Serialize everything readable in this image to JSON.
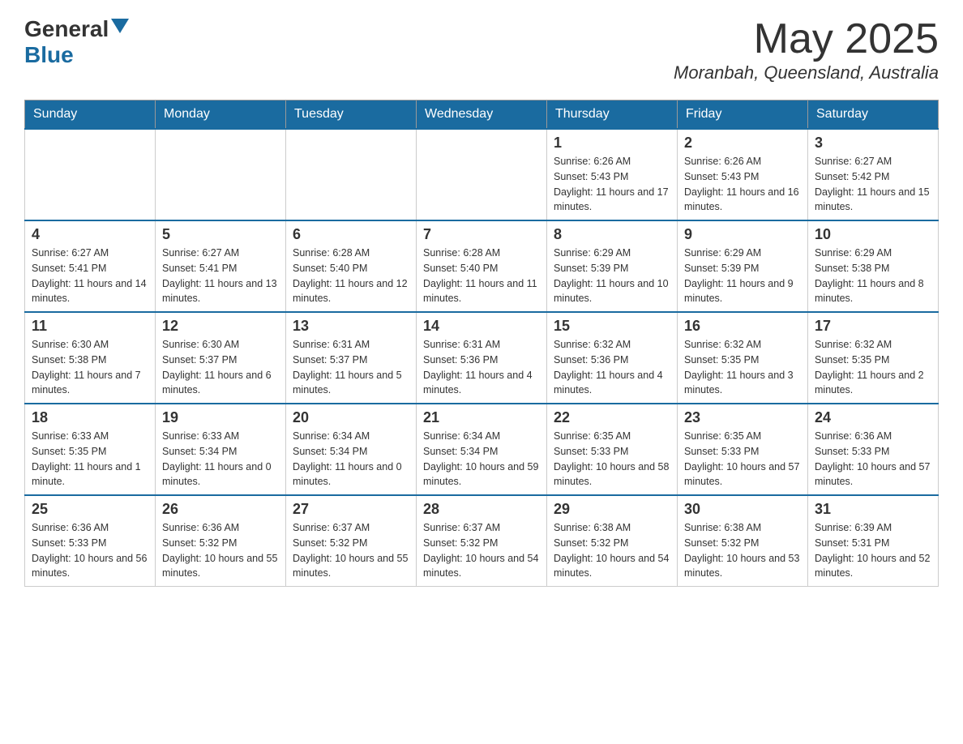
{
  "logo": {
    "general": "General",
    "blue": "Blue"
  },
  "title": "May 2025",
  "location": "Moranbah, Queensland, Australia",
  "days_of_week": [
    "Sunday",
    "Monday",
    "Tuesday",
    "Wednesday",
    "Thursday",
    "Friday",
    "Saturday"
  ],
  "weeks": [
    [
      {
        "day": "",
        "info": ""
      },
      {
        "day": "",
        "info": ""
      },
      {
        "day": "",
        "info": ""
      },
      {
        "day": "",
        "info": ""
      },
      {
        "day": "1",
        "info": "Sunrise: 6:26 AM\nSunset: 5:43 PM\nDaylight: 11 hours and 17 minutes."
      },
      {
        "day": "2",
        "info": "Sunrise: 6:26 AM\nSunset: 5:43 PM\nDaylight: 11 hours and 16 minutes."
      },
      {
        "day": "3",
        "info": "Sunrise: 6:27 AM\nSunset: 5:42 PM\nDaylight: 11 hours and 15 minutes."
      }
    ],
    [
      {
        "day": "4",
        "info": "Sunrise: 6:27 AM\nSunset: 5:41 PM\nDaylight: 11 hours and 14 minutes."
      },
      {
        "day": "5",
        "info": "Sunrise: 6:27 AM\nSunset: 5:41 PM\nDaylight: 11 hours and 13 minutes."
      },
      {
        "day": "6",
        "info": "Sunrise: 6:28 AM\nSunset: 5:40 PM\nDaylight: 11 hours and 12 minutes."
      },
      {
        "day": "7",
        "info": "Sunrise: 6:28 AM\nSunset: 5:40 PM\nDaylight: 11 hours and 11 minutes."
      },
      {
        "day": "8",
        "info": "Sunrise: 6:29 AM\nSunset: 5:39 PM\nDaylight: 11 hours and 10 minutes."
      },
      {
        "day": "9",
        "info": "Sunrise: 6:29 AM\nSunset: 5:39 PM\nDaylight: 11 hours and 9 minutes."
      },
      {
        "day": "10",
        "info": "Sunrise: 6:29 AM\nSunset: 5:38 PM\nDaylight: 11 hours and 8 minutes."
      }
    ],
    [
      {
        "day": "11",
        "info": "Sunrise: 6:30 AM\nSunset: 5:38 PM\nDaylight: 11 hours and 7 minutes."
      },
      {
        "day": "12",
        "info": "Sunrise: 6:30 AM\nSunset: 5:37 PM\nDaylight: 11 hours and 6 minutes."
      },
      {
        "day": "13",
        "info": "Sunrise: 6:31 AM\nSunset: 5:37 PM\nDaylight: 11 hours and 5 minutes."
      },
      {
        "day": "14",
        "info": "Sunrise: 6:31 AM\nSunset: 5:36 PM\nDaylight: 11 hours and 4 minutes."
      },
      {
        "day": "15",
        "info": "Sunrise: 6:32 AM\nSunset: 5:36 PM\nDaylight: 11 hours and 4 minutes."
      },
      {
        "day": "16",
        "info": "Sunrise: 6:32 AM\nSunset: 5:35 PM\nDaylight: 11 hours and 3 minutes."
      },
      {
        "day": "17",
        "info": "Sunrise: 6:32 AM\nSunset: 5:35 PM\nDaylight: 11 hours and 2 minutes."
      }
    ],
    [
      {
        "day": "18",
        "info": "Sunrise: 6:33 AM\nSunset: 5:35 PM\nDaylight: 11 hours and 1 minute."
      },
      {
        "day": "19",
        "info": "Sunrise: 6:33 AM\nSunset: 5:34 PM\nDaylight: 11 hours and 0 minutes."
      },
      {
        "day": "20",
        "info": "Sunrise: 6:34 AM\nSunset: 5:34 PM\nDaylight: 11 hours and 0 minutes."
      },
      {
        "day": "21",
        "info": "Sunrise: 6:34 AM\nSunset: 5:34 PM\nDaylight: 10 hours and 59 minutes."
      },
      {
        "day": "22",
        "info": "Sunrise: 6:35 AM\nSunset: 5:33 PM\nDaylight: 10 hours and 58 minutes."
      },
      {
        "day": "23",
        "info": "Sunrise: 6:35 AM\nSunset: 5:33 PM\nDaylight: 10 hours and 57 minutes."
      },
      {
        "day": "24",
        "info": "Sunrise: 6:36 AM\nSunset: 5:33 PM\nDaylight: 10 hours and 57 minutes."
      }
    ],
    [
      {
        "day": "25",
        "info": "Sunrise: 6:36 AM\nSunset: 5:33 PM\nDaylight: 10 hours and 56 minutes."
      },
      {
        "day": "26",
        "info": "Sunrise: 6:36 AM\nSunset: 5:32 PM\nDaylight: 10 hours and 55 minutes."
      },
      {
        "day": "27",
        "info": "Sunrise: 6:37 AM\nSunset: 5:32 PM\nDaylight: 10 hours and 55 minutes."
      },
      {
        "day": "28",
        "info": "Sunrise: 6:37 AM\nSunset: 5:32 PM\nDaylight: 10 hours and 54 minutes."
      },
      {
        "day": "29",
        "info": "Sunrise: 6:38 AM\nSunset: 5:32 PM\nDaylight: 10 hours and 54 minutes."
      },
      {
        "day": "30",
        "info": "Sunrise: 6:38 AM\nSunset: 5:32 PM\nDaylight: 10 hours and 53 minutes."
      },
      {
        "day": "31",
        "info": "Sunrise: 6:39 AM\nSunset: 5:31 PM\nDaylight: 10 hours and 52 minutes."
      }
    ]
  ]
}
